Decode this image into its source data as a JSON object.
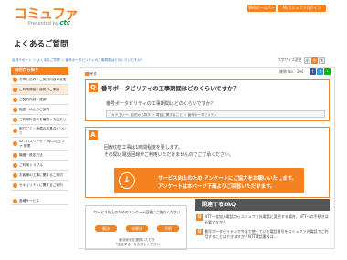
{
  "header": {
    "logo_main": "コミュファ",
    "logo_sub": "Presented by",
    "logo_brand": "ctc",
    "buttons": [
      "Webホームページ",
      "Myコミュファログイン"
    ]
  },
  "page_title": "よくあるご質問",
  "breadcrumb": "会員サポート ＞ よくあるご質問 ＞ 番号ポータビリティの工事期間はどのくらいですか？",
  "font_size": {
    "label": "文字サイズ変更",
    "options": [
      "小",
      "中",
      "大"
    ],
    "selected": "中"
  },
  "sidebar": {
    "heading": "目的から探す",
    "items": [
      {
        "label": "お申し込み・ご契約内容の変更"
      },
      {
        "label": "ご利用開始・接続のご案内"
      },
      {
        "label": "ご契約内容・確認"
      },
      {
        "label": "転居・休止のご案内"
      },
      {
        "label": "ご利用料金のお確認・お支払い"
      },
      {
        "label": "困りごと・故障の不具合について"
      },
      {
        "label": "ID・パスワード・Myコミュファ 管理"
      },
      {
        "label": "機器・設定方法"
      },
      {
        "label": "ご利用トラブル"
      },
      {
        "label": "お客様の工事に関するご案内"
      },
      {
        "label": "セキュリティに関するご案内"
      },
      {
        "label": "各種サービス"
      }
    ],
    "selected_index": 1
  },
  "main": {
    "back_label": "戻る",
    "question_no": "質問 No：164",
    "share_colors": [
      "#3b5998",
      "#1da1f2",
      "#00b900"
    ],
    "question": {
      "mark": "Q",
      "title": "番号ポータビリティの工事期間はどのくらいですか？",
      "subtitle": "番号ポータビリティの工事期間はどのくらいですか？",
      "breadcrumb": "カテゴリー：目的から探す ＞ 電話に関すること ＞ 番号ポータビリティ"
    },
    "answer": {
      "mark": "A",
      "lines": [
        "回線切替工事は1時間程度を要します。",
        "その間は電話回線がご利用いただけませんのでご了承ください。"
      ],
      "banner_line1": "サービス向上のため アンケートにご協力をお願いいたします。",
      "banner_line2": "アンケートは本ページ下部よりご回答いただけます。",
      "banner_icon": "down-arrow-icon"
    },
    "survey": {
      "title": "サービス向上のためのアンケート回答にご協力ください",
      "buttons": [
        "解決",
        "未解決",
        "不明"
      ],
      "note_lines": [
        "解決状況を選択いただき",
        "「送信する」をお押しください"
      ]
    },
    "related": {
      "heading": "関連するFAQ",
      "items": [
        "NTT一般加入電話からコミュファ光電話に変更する場合、NTTへの手続きは必要ですか？",
        "番号ポータビリティで今まで使っていた電話番号をコミュファ光電話でご利用することはできますか？NTT電話番号は…"
      ]
    }
  }
}
